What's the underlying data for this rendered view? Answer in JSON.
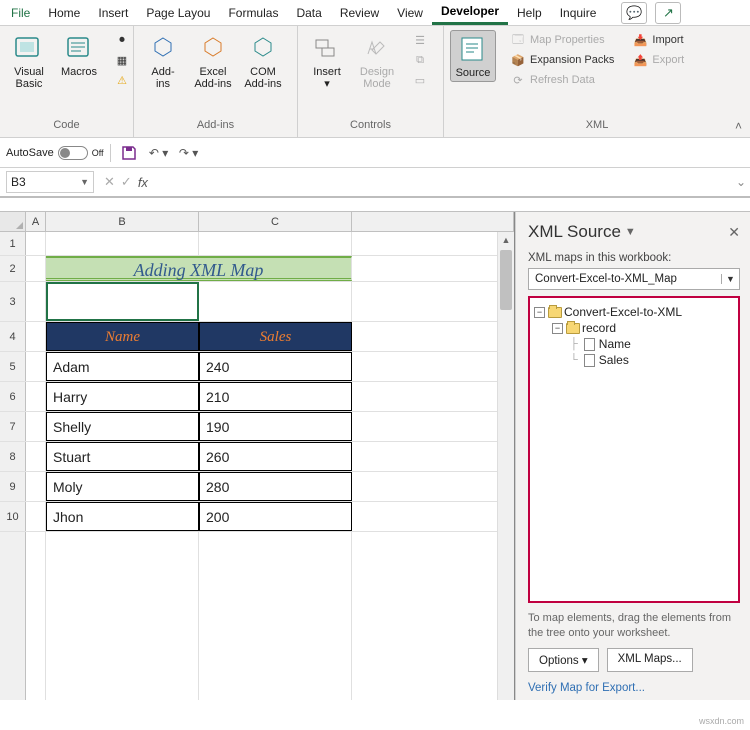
{
  "menu": {
    "file": "File",
    "home": "Home",
    "insert": "Insert",
    "pagelayout": "Page Layou",
    "formulas": "Formulas",
    "data": "Data",
    "review": "Review",
    "view": "View",
    "developer": "Developer",
    "help": "Help",
    "inquire": "Inquire"
  },
  "ribbon": {
    "code": {
      "label": "Code",
      "vb": "Visual\nBasic",
      "macros": "Macros"
    },
    "addins": {
      "label": "Add-ins",
      "addins": "Add-\nins",
      "excel": "Excel\nAdd-ins",
      "com": "COM\nAdd-ins"
    },
    "controls": {
      "label": "Controls",
      "insert": "Insert",
      "design": "Design\nMode"
    },
    "xml": {
      "label": "XML",
      "source": "Source",
      "mapprops": "Map Properties",
      "expansion": "Expansion Packs",
      "refresh": "Refresh Data",
      "import": "Import",
      "export": "Export"
    }
  },
  "qat": {
    "autosave": "AutoSave",
    "off": "Off"
  },
  "namebox": "B3",
  "sheet": {
    "cols": [
      "A",
      "B",
      "C"
    ],
    "title": "Adding XML Map",
    "headers": {
      "name": "Name",
      "sales": "Sales"
    },
    "rows": [
      {
        "n": "Adam",
        "s": "240"
      },
      {
        "n": "Harry",
        "s": "210"
      },
      {
        "n": "Shelly",
        "s": "190"
      },
      {
        "n": "Stuart",
        "s": "260"
      },
      {
        "n": "Moly",
        "s": "280"
      },
      {
        "n": "Jhon",
        "s": "200"
      }
    ]
  },
  "pane": {
    "title": "XML Source",
    "mapsLabel": "XML maps in this workbook:",
    "mapName": "Convert-Excel-to-XML_Map",
    "root": "Convert-Excel-to-XML",
    "record": "record",
    "nameNode": "Name",
    "salesNode": "Sales",
    "hint": "To map elements, drag the elements from the tree onto your worksheet.",
    "options": "Options",
    "xmlmaps": "XML Maps...",
    "verify": "Verify Map for Export..."
  },
  "watermark": "wsxdn.com"
}
